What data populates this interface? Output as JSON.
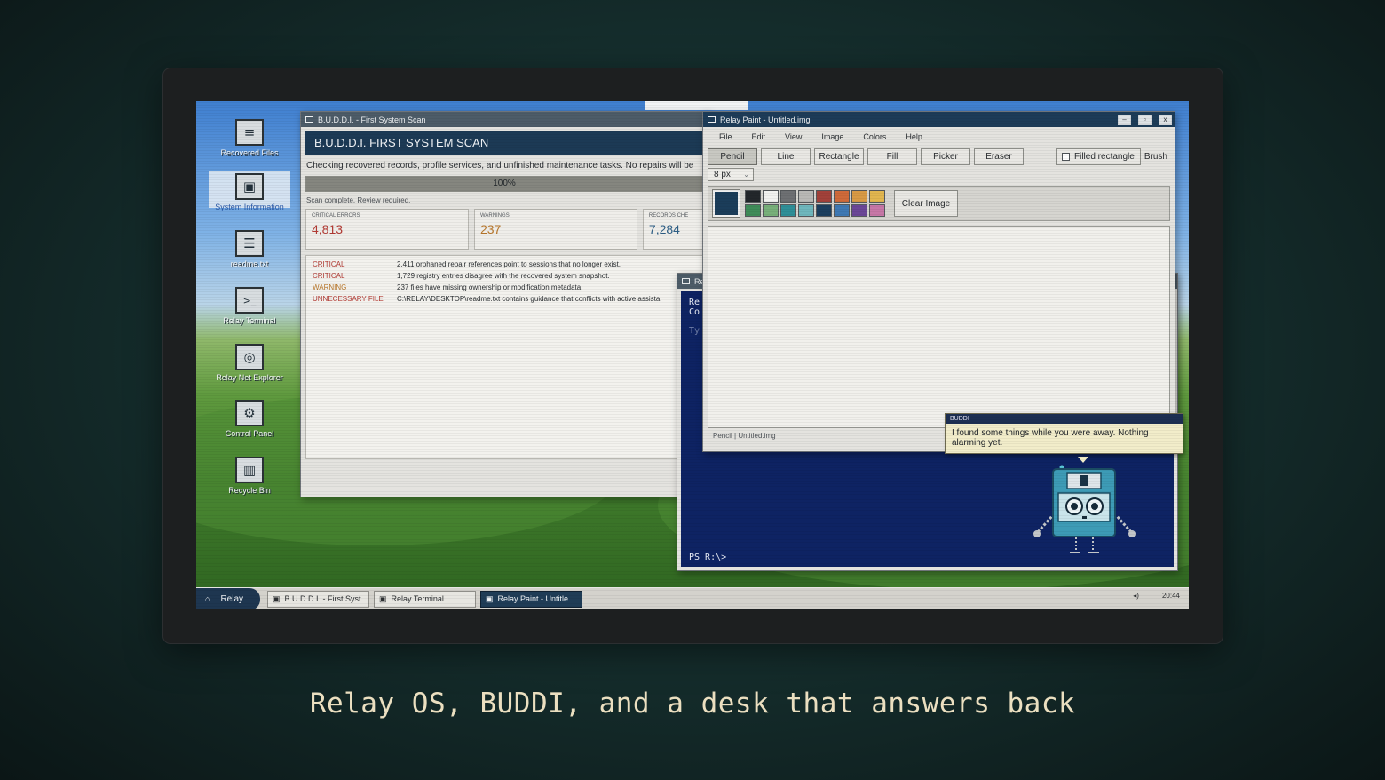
{
  "desktop": {
    "icons": [
      {
        "label": "Recovered Files",
        "glyph": "≡",
        "icon": "folder-icon"
      },
      {
        "label": "System Information",
        "glyph": "▣",
        "icon": "monitor-icon"
      },
      {
        "label": "readme.txt",
        "glyph": "☰",
        "icon": "document-icon"
      },
      {
        "label": "Relay Terminal",
        "glyph": ">_",
        "icon": "terminal-icon"
      },
      {
        "label": "Relay Net Explorer",
        "glyph": "◎",
        "icon": "globe-icon"
      },
      {
        "label": "Control Panel",
        "glyph": "⚙",
        "icon": "control-panel-icon"
      },
      {
        "label": "Recycle Bin",
        "glyph": "▥",
        "icon": "recycle-bin-icon"
      }
    ]
  },
  "scan": {
    "title": "B.U.D.D.I. - First System Scan",
    "heading": "B.U.D.D.I. FIRST SYSTEM SCAN",
    "description": "Checking recovered records, profile services, and unfinished maintenance tasks. No repairs will be",
    "progress_label": "100%",
    "progress": 1.0,
    "status": "Scan complete. Review required.",
    "cards": [
      {
        "key": "CRITICAL ERRORS",
        "value": "4,813",
        "color": "#b23a33"
      },
      {
        "key": "WARNINGS",
        "value": "237",
        "color": "#b8772b"
      },
      {
        "key": "RECORDS CHE",
        "value": "7,284",
        "color": "#2d5f86"
      }
    ],
    "log": [
      {
        "level": "CRITICAL",
        "msg": "2,411 orphaned repair references point to sessions that no longer exist.",
        "color": "#b23a33"
      },
      {
        "level": "CRITICAL",
        "msg": "1,729 registry entries disagree with the recovered system snapshot.",
        "color": "#b23a33"
      },
      {
        "level": "WARNING",
        "msg": "237 files have missing ownership or modification metadata.",
        "color": "#b8772b"
      },
      {
        "level": "UNNECESSARY FILE",
        "msg": "C:\\RELAY\\DESKTOP\\readme.txt contains guidance that conflicts with active assista",
        "color": "#b23a33"
      }
    ]
  },
  "terminal": {
    "title": "Re",
    "line1": "Re",
    "line2": "Co",
    "line3": "Ty",
    "prompt": "PS R:\\>"
  },
  "paint": {
    "title": "Relay Paint - Untitled.img",
    "menus": [
      "File",
      "Edit",
      "View",
      "Image",
      "Colors",
      "Help"
    ],
    "tools": [
      "Pencil",
      "Line",
      "Rectangle",
      "Fill",
      "Picker",
      "Eraser"
    ],
    "active_tool": "Pencil",
    "filled_label": "Filled rectangle",
    "brush_label": "Brush",
    "size": "8 px",
    "clear_label": "Clear Image",
    "current_color": "#1b3d5a",
    "palette": [
      "#23272b",
      "#f2f2f0",
      "#6e7073",
      "#b9b9b6",
      "#a2413a",
      "#cf6a3a",
      "#d89a45",
      "#e2b64f",
      "#3f8c59",
      "#78b07a",
      "#2f8f98",
      "#6fb7bd",
      "#1c3f5f",
      "#3f79b4",
      "#6b4797",
      "#c777a7"
    ],
    "status": "Pencil | Untitled.img"
  },
  "buddi": {
    "header": "BUDDI",
    "message": "I found some things while you were away. Nothing alarming yet."
  },
  "taskbar": {
    "start": "Relay",
    "tasks": [
      {
        "label": "B.U.D.D.I. - First Syst...",
        "active": false
      },
      {
        "label": "Relay Terminal",
        "active": false
      },
      {
        "label": "Relay Paint - Untitle...",
        "active": true
      }
    ],
    "volume_glyph": "◂)",
    "clock": "20:44"
  },
  "caption": "Relay OS, BUDDI, and a desk that answers back"
}
